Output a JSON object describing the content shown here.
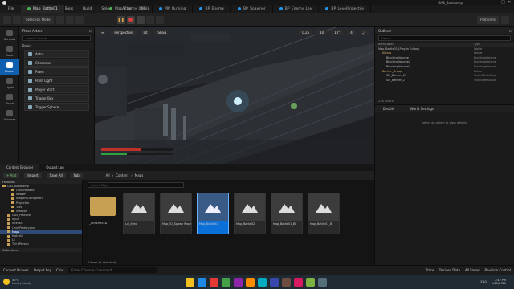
{
  "window": {
    "project_name": "GAS_Bootcamp",
    "tabs": [
      {
        "label": "Map_Battle01",
        "active": true,
        "color": "#4caf50"
      },
      {
        "label": "Map_Enemy_001",
        "active": false,
        "color": "#4caf50"
      },
      {
        "label": "MP_Burning",
        "active": false,
        "color": "#2196f3"
      },
      {
        "label": "BP_Enemy",
        "active": false,
        "color": "#2196f3"
      },
      {
        "label": "BP_Spawner",
        "active": false,
        "color": "#2196f3"
      },
      {
        "label": "BP_Enemy_Lev",
        "active": false,
        "color": "#2196f3"
      },
      {
        "label": "BP_LevelProjectile",
        "active": false,
        "color": "#2196f3"
      }
    ],
    "menu": [
      "File",
      "Edit",
      "Window",
      "Tools",
      "Build",
      "Select",
      "Actor",
      "Help"
    ]
  },
  "toolbar": {
    "mode_label": "Selection Mode",
    "platforms_label": "Platforms"
  },
  "left_sidebar": {
    "items": [
      {
        "label": "Controls",
        "icon": "controls-icon"
      },
      {
        "label": "Basic",
        "icon": "basic-icon"
      },
      {
        "label": "Shaper",
        "icon": "shaper-icon"
      },
      {
        "label": "Lights",
        "icon": "lights-icon"
      },
      {
        "label": "Visual",
        "icon": "visual-icon"
      },
      {
        "label": "Volumes",
        "icon": "volumes-icon"
      }
    ]
  },
  "place_actions": {
    "title": "Place Actors",
    "search_placeholder": "Search Classes",
    "category": "Basic",
    "items": [
      "Actor",
      "Character",
      "Pawn",
      "Point Light",
      "Player Start",
      "Trigger Box",
      "Trigger Sphere"
    ]
  },
  "viewport": {
    "view_label": "Perspective",
    "lit_label": "Lit",
    "show_label": "Show",
    "scale_label": "0.25",
    "grid_value": "10",
    "angle_value": "10°",
    "speed_value": "4",
    "health_fill": 0.55,
    "mana_fill": 0.35
  },
  "outliner": {
    "title": "Outliner",
    "search_placeholder": "Search...",
    "col_label": "Item Label",
    "col_type": "Type",
    "rows": [
      {
        "label": "Map_Battle01 (Play In Editor)",
        "type": "World",
        "indent": 0,
        "sel": false
      },
      {
        "label": "Actors",
        "type": "Folder",
        "indent": 1,
        "sel": false
      },
      {
        "label": "BlockingVolume",
        "type": "BlockingVolume",
        "indent": 2,
        "sel": false
      },
      {
        "label": "BlockingVolume2",
        "type": "BlockingVolume",
        "indent": 2,
        "sel": false
      },
      {
        "label": "BlockingVolume3",
        "type": "BlockingVolume",
        "indent": 2,
        "sel": false
      },
      {
        "label": "Barrier_Group",
        "type": "Folder",
        "indent": 1,
        "sel": false
      },
      {
        "label": "SM_Barrier_01",
        "type": "StaticMeshActor",
        "indent": 2,
        "sel": false
      },
      {
        "label": "SM_Barrier_2",
        "type": "StaticMeshActor",
        "indent": 2,
        "sel": false
      }
    ],
    "actor_count": "236 actors"
  },
  "details": {
    "tab_details": "Details",
    "tab_world": "World Settings",
    "empty_text": "Select an object to view details."
  },
  "content_browser": {
    "tab_cb": "Content Browser",
    "tab_log": "Output Log",
    "add_label": "+ Add",
    "import_label": "Import",
    "save_all_label": "Save All",
    "fab_label": "Fab",
    "path": [
      "All",
      "Content",
      "Maps"
    ],
    "search_placeholder": "Search Maps",
    "favorites_label": "Favorites",
    "project_root": "GAS_Bootcamp",
    "tree": [
      {
        "label": "LevelRelated",
        "indent": 3,
        "sel": false
      },
      {
        "label": "NewBP",
        "indent": 3,
        "sel": false
      },
      {
        "label": "NiagaraComponent",
        "indent": 3,
        "sel": false
      },
      {
        "label": "Projectile",
        "indent": 3,
        "sel": false
      },
      {
        "label": "Text",
        "indent": 3,
        "sel": false
      },
      {
        "label": "Weapon",
        "indent": 3,
        "sel": false
      },
      {
        "label": "GAS_Practice",
        "indent": 2,
        "sel": false
      },
      {
        "label": "Input",
        "indent": 2,
        "sel": false
      },
      {
        "label": "Interact",
        "indent": 2,
        "sel": false
      },
      {
        "label": "LevelPrototyping",
        "indent": 2,
        "sel": false
      },
      {
        "label": "Maps",
        "indent": 2,
        "sel": true
      },
      {
        "label": "Material",
        "indent": 2,
        "sel": false
      },
      {
        "label": "UI",
        "indent": 2,
        "sel": false
      },
      {
        "label": "ThirdPerson",
        "indent": 2,
        "sel": false
      }
    ],
    "collections_label": "Collections",
    "assets": [
      {
        "label": "_GENERATED",
        "kind": "folder",
        "sel": false
      },
      {
        "label": "Lvl_Intro",
        "kind": "map",
        "sel": false
      },
      {
        "label": "Map_01_Spawn Room",
        "kind": "map",
        "sel": false
      },
      {
        "label": "Map_Battle01",
        "kind": "map",
        "sel": true
      },
      {
        "label": "Map_Battle02",
        "kind": "map",
        "sel": false
      },
      {
        "label": "Map_Battle01_Bil",
        "kind": "map",
        "sel": false
      },
      {
        "label": "Map_Battle01_BI",
        "kind": "map",
        "sel": false
      }
    ],
    "item_count": "7 items (1 selected)"
  },
  "status": {
    "cb_label": "Content Drawer",
    "log_label": "Output Log",
    "cmd_label": "Cmd",
    "cmd_placeholder": "Enter Console Command",
    "trace_label": "Trace",
    "derived_label": "Derived Data",
    "all_saved_label": "All Saved",
    "revision_label": "Revision Control"
  },
  "taskbar": {
    "weather_temp": "30°C",
    "weather_desc": "Mostly cloudy",
    "time": "7:42 PM",
    "date": "2/25/2025",
    "lang": "ENG",
    "icons": [
      "#f0c020",
      "#1e88e5",
      "#e53935",
      "#43a047",
      "#8e24aa",
      "#fb8c00",
      "#00acc1",
      "#3949ab",
      "#6d4c41",
      "#d81b60",
      "#7cb342",
      "#546e7a"
    ]
  }
}
